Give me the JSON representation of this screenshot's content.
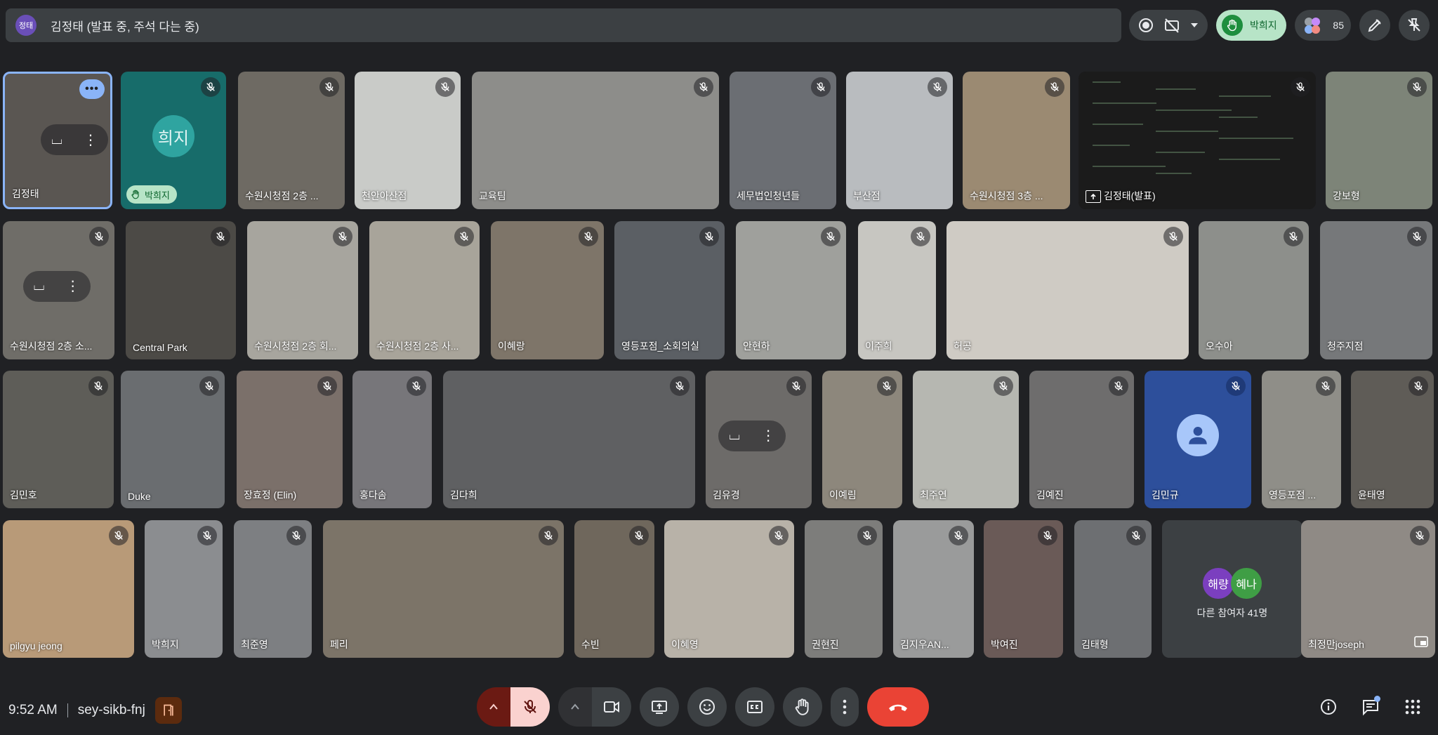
{
  "presenter_bar": {
    "avatar_text": "정태",
    "text": "김정태 (발표 중, 주석 다는 중)"
  },
  "top_controls": {
    "raised_hand_name": "박희지",
    "participant_count": "85"
  },
  "tiles": [
    {
      "name": "김정태",
      "bg": "#5a5652"
    },
    {
      "name": "박희지",
      "initials": "희지",
      "bg": "#176c6a"
    },
    {
      "name": "수원시청점 2층 ...",
      "bg": "#6e6a63"
    },
    {
      "name": "천안아산점",
      "bg": "#c9cbc8"
    },
    {
      "name": "교육팀",
      "bg": "#8d8d8a"
    },
    {
      "name": "세무법인청년들",
      "bg": "#6b6e73"
    },
    {
      "name": "부산점",
      "bg": "#b9bcbf"
    },
    {
      "name": "수원시청점 3층 ...",
      "bg": "#9b8a72"
    },
    {
      "name": "김정태(발표)",
      "bg": "#1b1b1b"
    },
    {
      "name": "강보형",
      "bg": "#7d8478"
    },
    {
      "name": "수원시청점 2층 소...",
      "bg": "#6f6d68"
    },
    {
      "name": "Central Park",
      "bg": "#4c4a46"
    },
    {
      "name": "수원시청점 2층 회...",
      "bg": "#a7a59e"
    },
    {
      "name": "수원시청점 2층 사...",
      "bg": "#a8a49a"
    },
    {
      "name": "이혜랑",
      "bg": "#7e7569"
    },
    {
      "name": "영등포점_소회의실",
      "bg": "#5b5f64"
    },
    {
      "name": "안현하",
      "bg": "#9fa09c"
    },
    {
      "name": "이주희",
      "bg": "#c7c6c1"
    },
    {
      "name": "허공",
      "bg": "#cfcbc4"
    },
    {
      "name": "오수아",
      "bg": "#8d8f8b"
    },
    {
      "name": "청주지점",
      "bg": "#76787a"
    },
    {
      "name": "김민호",
      "bg": "#5e5d58"
    },
    {
      "name": "Duke",
      "bg": "#6a6d70"
    },
    {
      "name": "장효정 (Elin)",
      "bg": "#7b706a"
    },
    {
      "name": "홍다솜",
      "bg": "#77767a"
    },
    {
      "name": "김다희",
      "bg": "#5f6062"
    },
    {
      "name": "김유경",
      "bg": "#6d6b69"
    },
    {
      "name": "이예림",
      "bg": "#8d877c"
    },
    {
      "name": "최주연",
      "bg": "#b6b7b1"
    },
    {
      "name": "김예진",
      "bg": "#6e6d6d"
    },
    {
      "name": "김민규",
      "bg": "#2d4f9b"
    },
    {
      "name": "영등포점 ...",
      "bg": "#8f8e88"
    },
    {
      "name": "윤태영",
      "bg": "#5f5c57"
    },
    {
      "name": "pilgyu jeong",
      "bg": "#b89a78"
    },
    {
      "name": "박희지",
      "bg": "#8b8d90"
    },
    {
      "name": "최준영",
      "bg": "#7d7f82"
    },
    {
      "name": "페리",
      "bg": "#7c7468"
    },
    {
      "name": "수빈",
      "bg": "#6f675c"
    },
    {
      "name": "이혜영",
      "bg": "#b8b2a8"
    },
    {
      "name": "권현진",
      "bg": "#7d7d7b"
    },
    {
      "name": "김지우AN...",
      "bg": "#9a9b9b"
    },
    {
      "name": "박여진",
      "bg": "#6a5a57"
    },
    {
      "name": "김태형",
      "bg": "#6d6f72"
    },
    {
      "name": "다른 참여자 41명",
      "avatars": [
        "해량",
        "혜나"
      ]
    },
    {
      "name": "최정만joseph",
      "bg": "#8f8a85"
    }
  ],
  "others_avatar_colors": [
    "#7b3fbf",
    "#3f9e45"
  ],
  "bottom": {
    "time": "9:52 AM",
    "meeting_code": "sey-sikb-fnj"
  },
  "colors": {
    "background": "#202124",
    "accent": "#8ab4f8",
    "hangup": "#ea4335",
    "mic_off_bg": "#fad2cf"
  }
}
